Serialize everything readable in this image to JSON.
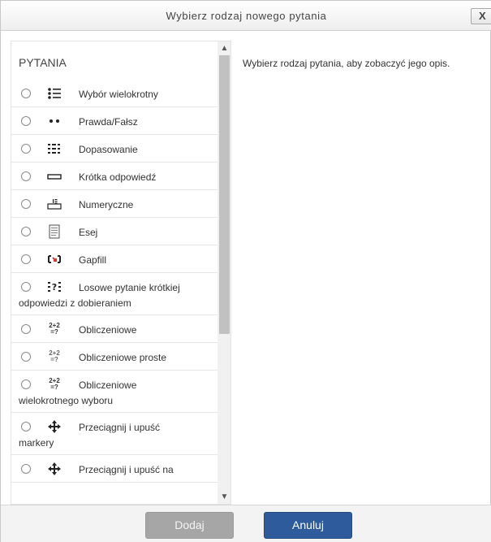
{
  "dialog": {
    "title": "Wybierz rodzaj nowego pytania",
    "close_label": "X"
  },
  "list": {
    "section_heading": "PYTANIA",
    "items": [
      {
        "label": "Wybór wielokrotny",
        "label_cont": "",
        "icon": "multiple-choice-icon"
      },
      {
        "label": "Prawda/Fałsz",
        "label_cont": "",
        "icon": "true-false-icon"
      },
      {
        "label": "Dopasowanie",
        "label_cont": "",
        "icon": "matching-icon"
      },
      {
        "label": "Krótka odpowiedź",
        "label_cont": "",
        "icon": "short-answer-icon"
      },
      {
        "label": "Numeryczne",
        "label_cont": "",
        "icon": "numerical-icon"
      },
      {
        "label": "Esej",
        "label_cont": "",
        "icon": "essay-icon"
      },
      {
        "label": "Gapfill",
        "label_cont": "",
        "icon": "gapfill-icon"
      },
      {
        "label": "Losowe pytanie krótkiej",
        "label_cont": "odpowiedzi z dobieraniem",
        "icon": "random-short-answer-matching-icon"
      },
      {
        "label": "Obliczeniowe",
        "label_cont": "",
        "icon": "calculated-icon",
        "icon_text_top": "2+2",
        "icon_text_bottom": "=?"
      },
      {
        "label": "Obliczeniowe proste",
        "label_cont": "",
        "icon": "calculated-simple-icon",
        "icon_text_top": "2+2",
        "icon_text_bottom": "=?"
      },
      {
        "label": "Obliczeniowe",
        "label_cont": "wielokrotnego wyboru",
        "icon": "calculated-multichoice-icon",
        "icon_text_top": "2+2",
        "icon_text_bottom": "=?"
      },
      {
        "label": "Przeciągnij i upuść",
        "label_cont": "markery",
        "icon": "drag-drop-markers-icon"
      },
      {
        "label": "Przeciągnij i upuść na",
        "label_cont": "",
        "icon": "drag-drop-image-icon"
      }
    ],
    "scroll_up_glyph": "▲",
    "scroll_down_glyph": "▼"
  },
  "description": {
    "text": "Wybierz rodzaj pytania, aby zobaczyć jego opis."
  },
  "footer": {
    "add_label": "Dodaj",
    "cancel_label": "Anuluj"
  },
  "colors": {
    "cancel_button": "#2d5b9c",
    "add_button_disabled": "#a6a6a6",
    "footer_bg": "#f3f3f3",
    "gapfill_accent": "#d9342b"
  }
}
